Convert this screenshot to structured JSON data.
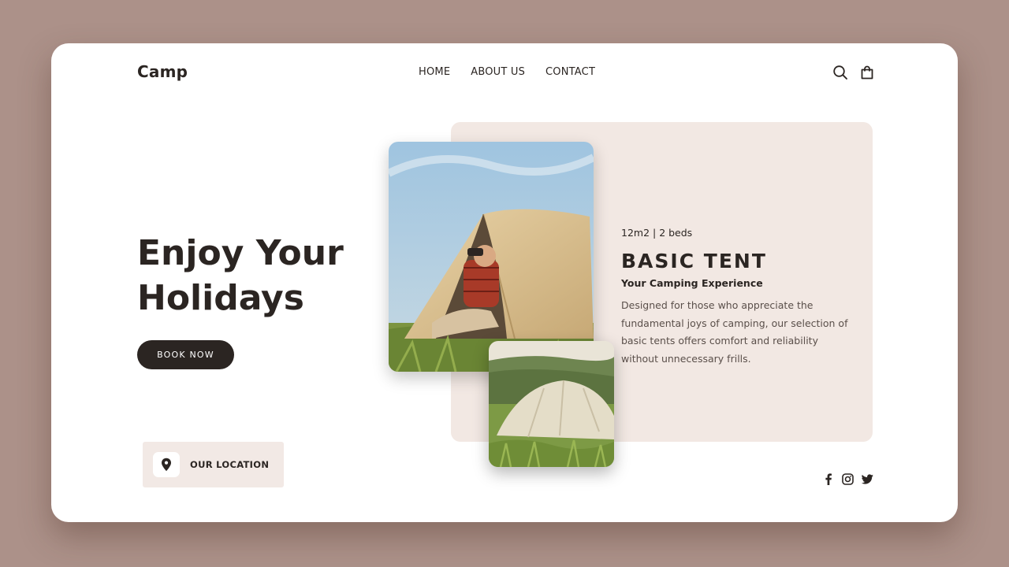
{
  "brand": "Camp",
  "nav": [
    {
      "label": "HOME"
    },
    {
      "label": "ABOUT US"
    },
    {
      "label": "CONTACT"
    }
  ],
  "header_icons": [
    "search-icon",
    "shopping-bag-icon"
  ],
  "hero": {
    "title_line1": "Enjoy Your",
    "title_line2": "Holidays",
    "cta_label": "BOOK NOW"
  },
  "location": {
    "label": "OUR LOCATION",
    "icon": "map-pin-icon"
  },
  "product": {
    "specs": "12m2 | 2 beds",
    "title": "BASIC TENT",
    "subtitle": "Your Camping Experience",
    "description": "Designed for those who appreciate the fundamental joys of camping, our selection of basic tents offers comfort and reliability without unnecessary frills."
  },
  "social_icons": [
    "facebook-icon",
    "instagram-icon",
    "twitter-icon"
  ],
  "colors": {
    "background": "#ac9189",
    "card": "#ffffff",
    "panel": "#f2e8e3",
    "accent_dark": "#2b2522"
  }
}
